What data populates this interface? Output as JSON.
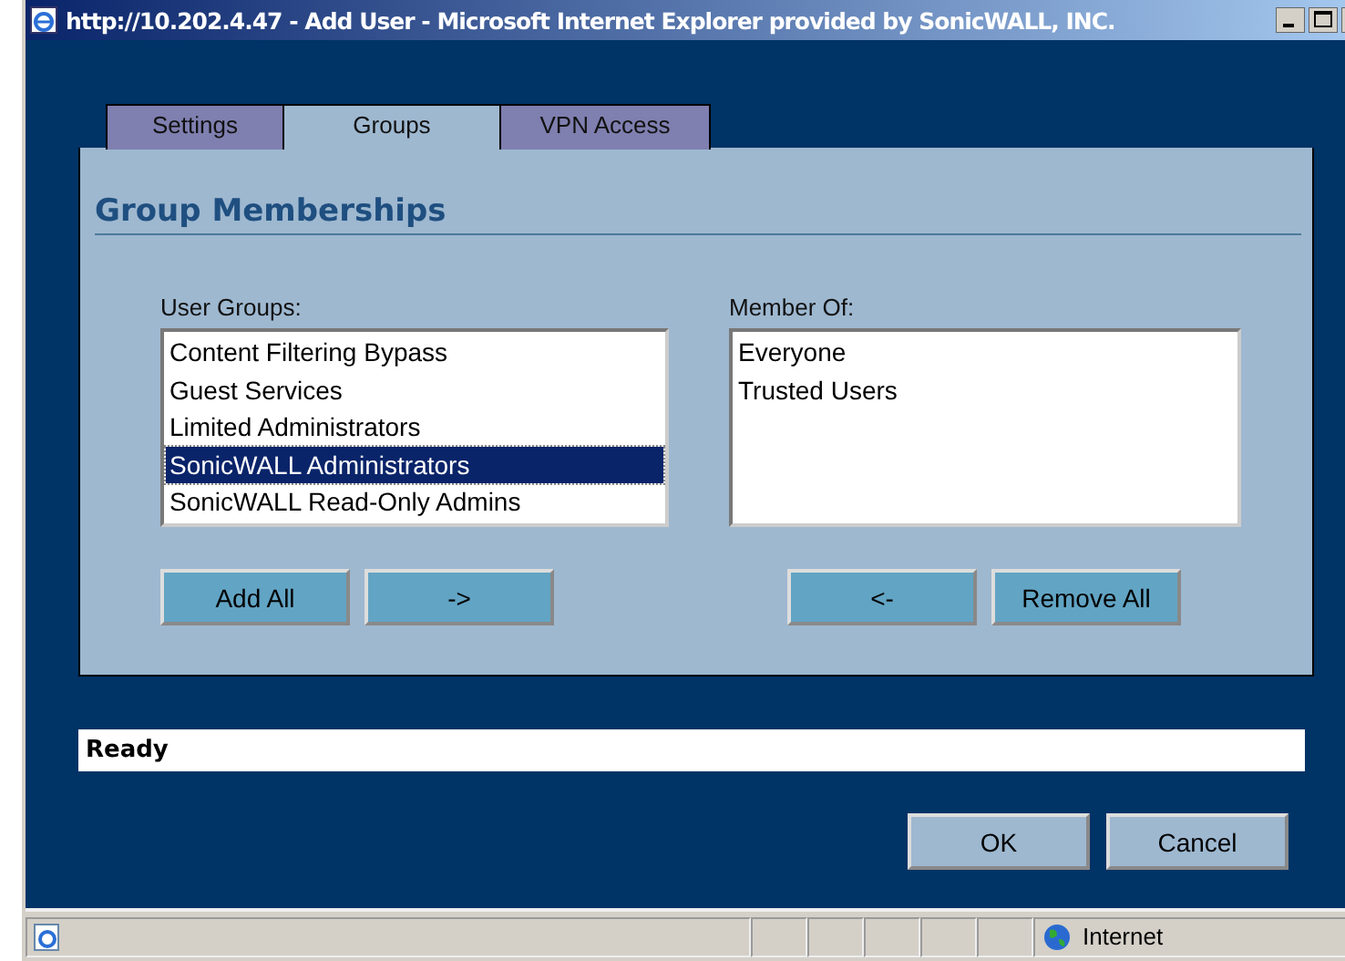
{
  "window": {
    "title": "http://10.202.4.47 - Add User - Microsoft Internet Explorer provided by SonicWALL, INC."
  },
  "tabs": [
    {
      "label": "Settings",
      "selected": false
    },
    {
      "label": "Groups",
      "selected": true
    },
    {
      "label": "VPN Access",
      "selected": false
    }
  ],
  "heading": "Group Memberships",
  "user_groups": {
    "label": "User Groups:",
    "items": [
      {
        "label": "Content Filtering Bypass",
        "selected": false
      },
      {
        "label": "Guest Services",
        "selected": false
      },
      {
        "label": "Limited Administrators",
        "selected": false
      },
      {
        "label": "SonicWALL Administrators",
        "selected": true
      },
      {
        "label": "SonicWALL Read-Only Admins",
        "selected": false
      }
    ]
  },
  "member_of": {
    "label": "Member Of:",
    "items": [
      {
        "label": "Everyone",
        "selected": false
      },
      {
        "label": "Trusted Users",
        "selected": false
      }
    ]
  },
  "left_buttons": [
    "Add All",
    "->"
  ],
  "right_buttons": [
    "<-",
    "Remove All"
  ],
  "message": "Ready",
  "dialog_buttons": [
    "OK",
    "Cancel"
  ],
  "status_bar": {
    "zone": "Internet"
  }
}
